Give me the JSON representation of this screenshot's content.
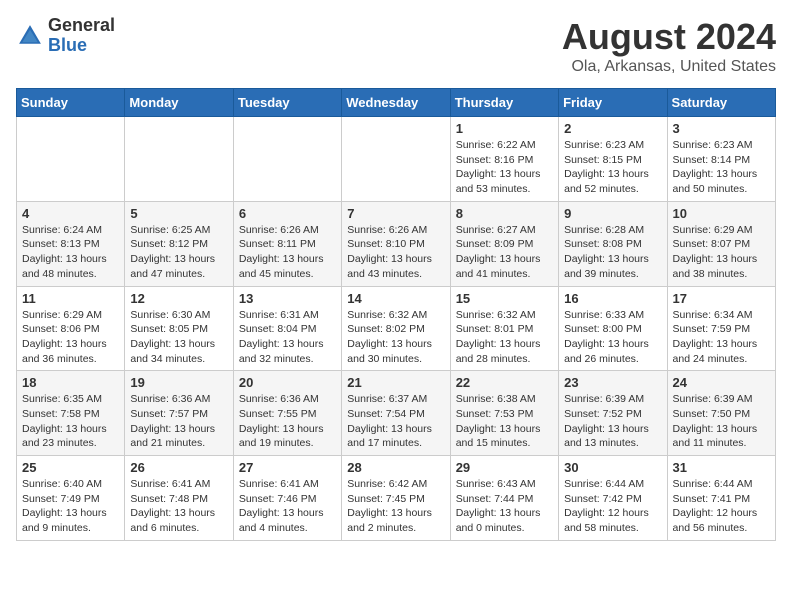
{
  "header": {
    "logo_general": "General",
    "logo_blue": "Blue",
    "month_title": "August 2024",
    "location": "Ola, Arkansas, United States"
  },
  "days_of_week": [
    "Sunday",
    "Monday",
    "Tuesday",
    "Wednesday",
    "Thursday",
    "Friday",
    "Saturday"
  ],
  "weeks": [
    [
      {
        "day": "",
        "info": ""
      },
      {
        "day": "",
        "info": ""
      },
      {
        "day": "",
        "info": ""
      },
      {
        "day": "",
        "info": ""
      },
      {
        "day": "1",
        "info": "Sunrise: 6:22 AM\nSunset: 8:16 PM\nDaylight: 13 hours\nand 53 minutes."
      },
      {
        "day": "2",
        "info": "Sunrise: 6:23 AM\nSunset: 8:15 PM\nDaylight: 13 hours\nand 52 minutes."
      },
      {
        "day": "3",
        "info": "Sunrise: 6:23 AM\nSunset: 8:14 PM\nDaylight: 13 hours\nand 50 minutes."
      }
    ],
    [
      {
        "day": "4",
        "info": "Sunrise: 6:24 AM\nSunset: 8:13 PM\nDaylight: 13 hours\nand 48 minutes."
      },
      {
        "day": "5",
        "info": "Sunrise: 6:25 AM\nSunset: 8:12 PM\nDaylight: 13 hours\nand 47 minutes."
      },
      {
        "day": "6",
        "info": "Sunrise: 6:26 AM\nSunset: 8:11 PM\nDaylight: 13 hours\nand 45 minutes."
      },
      {
        "day": "7",
        "info": "Sunrise: 6:26 AM\nSunset: 8:10 PM\nDaylight: 13 hours\nand 43 minutes."
      },
      {
        "day": "8",
        "info": "Sunrise: 6:27 AM\nSunset: 8:09 PM\nDaylight: 13 hours\nand 41 minutes."
      },
      {
        "day": "9",
        "info": "Sunrise: 6:28 AM\nSunset: 8:08 PM\nDaylight: 13 hours\nand 39 minutes."
      },
      {
        "day": "10",
        "info": "Sunrise: 6:29 AM\nSunset: 8:07 PM\nDaylight: 13 hours\nand 38 minutes."
      }
    ],
    [
      {
        "day": "11",
        "info": "Sunrise: 6:29 AM\nSunset: 8:06 PM\nDaylight: 13 hours\nand 36 minutes."
      },
      {
        "day": "12",
        "info": "Sunrise: 6:30 AM\nSunset: 8:05 PM\nDaylight: 13 hours\nand 34 minutes."
      },
      {
        "day": "13",
        "info": "Sunrise: 6:31 AM\nSunset: 8:04 PM\nDaylight: 13 hours\nand 32 minutes."
      },
      {
        "day": "14",
        "info": "Sunrise: 6:32 AM\nSunset: 8:02 PM\nDaylight: 13 hours\nand 30 minutes."
      },
      {
        "day": "15",
        "info": "Sunrise: 6:32 AM\nSunset: 8:01 PM\nDaylight: 13 hours\nand 28 minutes."
      },
      {
        "day": "16",
        "info": "Sunrise: 6:33 AM\nSunset: 8:00 PM\nDaylight: 13 hours\nand 26 minutes."
      },
      {
        "day": "17",
        "info": "Sunrise: 6:34 AM\nSunset: 7:59 PM\nDaylight: 13 hours\nand 24 minutes."
      }
    ],
    [
      {
        "day": "18",
        "info": "Sunrise: 6:35 AM\nSunset: 7:58 PM\nDaylight: 13 hours\nand 23 minutes."
      },
      {
        "day": "19",
        "info": "Sunrise: 6:36 AM\nSunset: 7:57 PM\nDaylight: 13 hours\nand 21 minutes."
      },
      {
        "day": "20",
        "info": "Sunrise: 6:36 AM\nSunset: 7:55 PM\nDaylight: 13 hours\nand 19 minutes."
      },
      {
        "day": "21",
        "info": "Sunrise: 6:37 AM\nSunset: 7:54 PM\nDaylight: 13 hours\nand 17 minutes."
      },
      {
        "day": "22",
        "info": "Sunrise: 6:38 AM\nSunset: 7:53 PM\nDaylight: 13 hours\nand 15 minutes."
      },
      {
        "day": "23",
        "info": "Sunrise: 6:39 AM\nSunset: 7:52 PM\nDaylight: 13 hours\nand 13 minutes."
      },
      {
        "day": "24",
        "info": "Sunrise: 6:39 AM\nSunset: 7:50 PM\nDaylight: 13 hours\nand 11 minutes."
      }
    ],
    [
      {
        "day": "25",
        "info": "Sunrise: 6:40 AM\nSunset: 7:49 PM\nDaylight: 13 hours\nand 9 minutes."
      },
      {
        "day": "26",
        "info": "Sunrise: 6:41 AM\nSunset: 7:48 PM\nDaylight: 13 hours\nand 6 minutes."
      },
      {
        "day": "27",
        "info": "Sunrise: 6:41 AM\nSunset: 7:46 PM\nDaylight: 13 hours\nand 4 minutes."
      },
      {
        "day": "28",
        "info": "Sunrise: 6:42 AM\nSunset: 7:45 PM\nDaylight: 13 hours\nand 2 minutes."
      },
      {
        "day": "29",
        "info": "Sunrise: 6:43 AM\nSunset: 7:44 PM\nDaylight: 13 hours\nand 0 minutes."
      },
      {
        "day": "30",
        "info": "Sunrise: 6:44 AM\nSunset: 7:42 PM\nDaylight: 12 hours\nand 58 minutes."
      },
      {
        "day": "31",
        "info": "Sunrise: 6:44 AM\nSunset: 7:41 PM\nDaylight: 12 hours\nand 56 minutes."
      }
    ]
  ]
}
